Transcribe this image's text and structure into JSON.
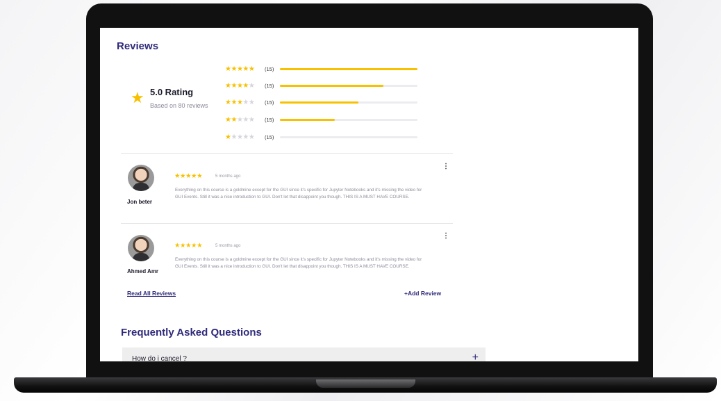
{
  "reviews": {
    "title": "Reviews",
    "summary": {
      "rating_label": "5.0 Rating",
      "subtitle": "Based on 80 reviews"
    },
    "breakdown": [
      {
        "stars": 5,
        "count": "(15)",
        "fill": 1.0
      },
      {
        "stars": 4,
        "count": "(15)",
        "fill": 0.75
      },
      {
        "stars": 3,
        "count": "(15)",
        "fill": 0.57
      },
      {
        "stars": 2,
        "count": "(15)",
        "fill": 0.4
      },
      {
        "stars": 1,
        "count": "(15)",
        "fill": 0.0
      }
    ],
    "items": [
      {
        "name": "Jon beter",
        "stars": "★★★★★",
        "time": "5 months ago",
        "text": "Everything on this course is a goldmine except for the GUI since it's specific for Jupyter Notebooks and it's missing the video for GUI Events. Still it was a nice introduction to GUI. Don't let that disappoint you though. THIS IS A MUST HAVE COURSE.",
        "menu": "⋮"
      },
      {
        "name": "Ahmed Amr",
        "stars": "★★★★★",
        "time": "5 months ago",
        "text": "Everything on this course is a goldmine except for the GUI since it's specific for Jupyter Notebooks and it's missing the video for GUI Events. Still it was a nice introduction to GUI. Don't let that disappoint you though. THIS IS A MUST HAVE COURSE.",
        "menu": "⋮"
      }
    ],
    "read_all": "Read All  Reviews",
    "add_review": "+Add  Review"
  },
  "faq": {
    "title": "Frequently Asked Questions",
    "items": [
      {
        "question": "How do i cancel ?",
        "icon": "+"
      }
    ]
  },
  "colors": {
    "accent": "#2f2a7a",
    "star": "#f7c100"
  }
}
